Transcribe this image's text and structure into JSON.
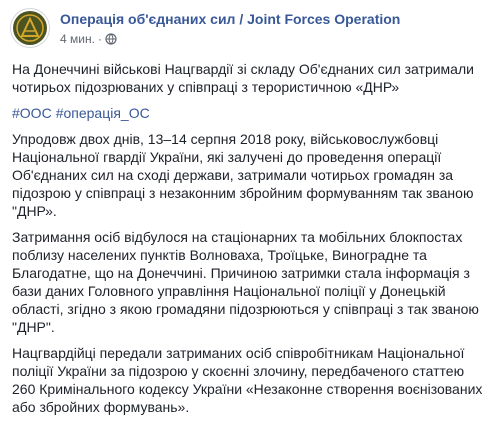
{
  "header": {
    "page_name": "Операція об'єднаних сил / Joint Forces Operation",
    "time": "4 мин.",
    "separator": "·",
    "privacy_icon": "globe-icon",
    "avatar_icon": "jfo-emblem-icon"
  },
  "post": {
    "headline": "На Донеччині військові Нацгвардії зі складу Об'єднаних сил затримали чотирьох підозрюваних у співпраці з терористичною «ДНР»",
    "hashtags": [
      "#ООС",
      "#операція_ОС"
    ],
    "paragraphs": [
      "Упродовж двох днів, 13–14 серпня 2018 року, військовослужбовці Національної гвардії України, які залучені до проведення операції Об'єднаних сил на сході держави, затримали чотирьох громадян за підозрою у співпраці з незаконним збройним формуванням так званою \"ДНР».",
      "Затримання осіб відбулося на стаціонарних та мобільних блокпостах поблизу населених пунктів Волноваха, Троїцьке, Виноградне та Благодатне, що на Донеччині. Причиною затримки стала інформація з бази даних Головного управління Національної поліції у Донецькій області, згідно з якою громадяни підозрюються у співпраці з так званою \"ДНР\".",
      "Нацгвардійці передали затриманих осіб співробітникам Національної поліції України за підозрою у скоєнні злочину, передбаченого статтею 260 Кримінального кодексу України «Незаконне створення воєнізованих або збройних формувань»."
    ]
  },
  "colors": {
    "link": "#385898",
    "text": "#1d2129",
    "meta": "#616770",
    "emblem_green": "#4b5320",
    "emblem_gold": "#d4a72c"
  }
}
